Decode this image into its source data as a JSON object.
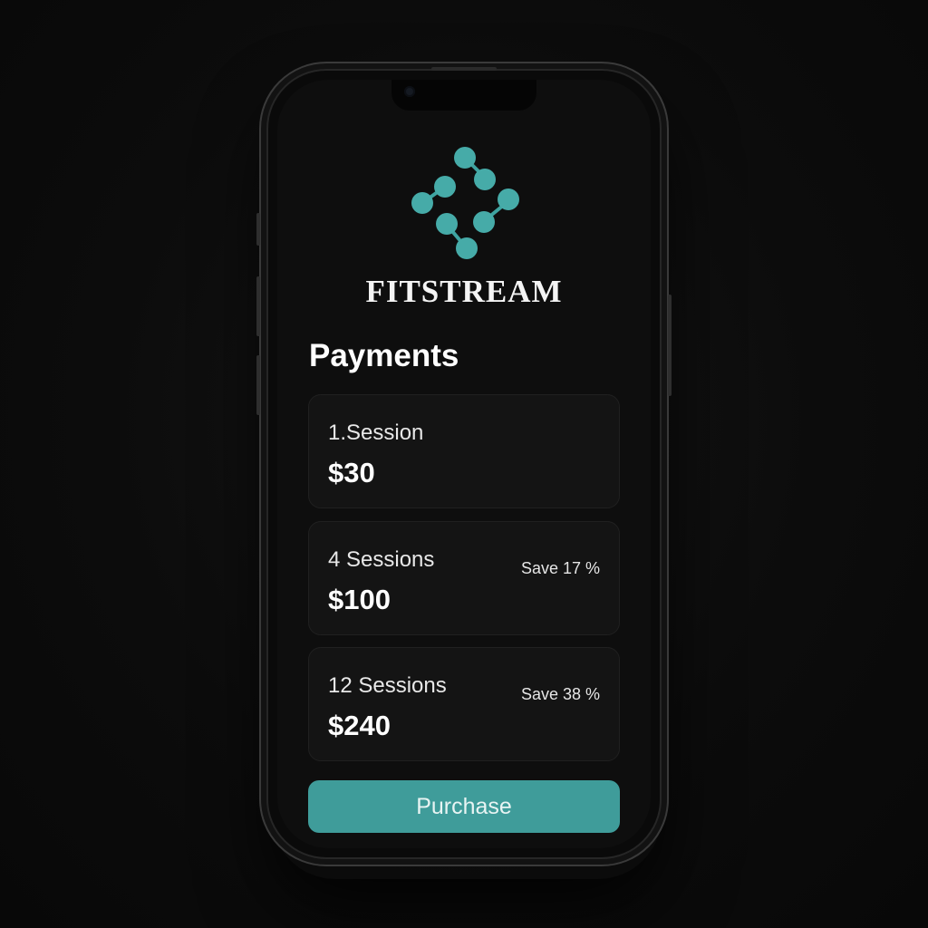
{
  "app": {
    "brand_name": "FITSTREAM",
    "logo_icon": "molecule-dots-icon",
    "accent_color": "#44a6a4"
  },
  "page": {
    "title": "Payments"
  },
  "plans": [
    {
      "name": "1.Session",
      "price": "$30",
      "save": ""
    },
    {
      "name": "4 Sessions",
      "price": "$100",
      "save": "Save 17 %"
    },
    {
      "name": "12 Sessions",
      "price": "$240",
      "save": "Save 38 %"
    }
  ],
  "actions": {
    "purchase_label": "Purchase"
  }
}
